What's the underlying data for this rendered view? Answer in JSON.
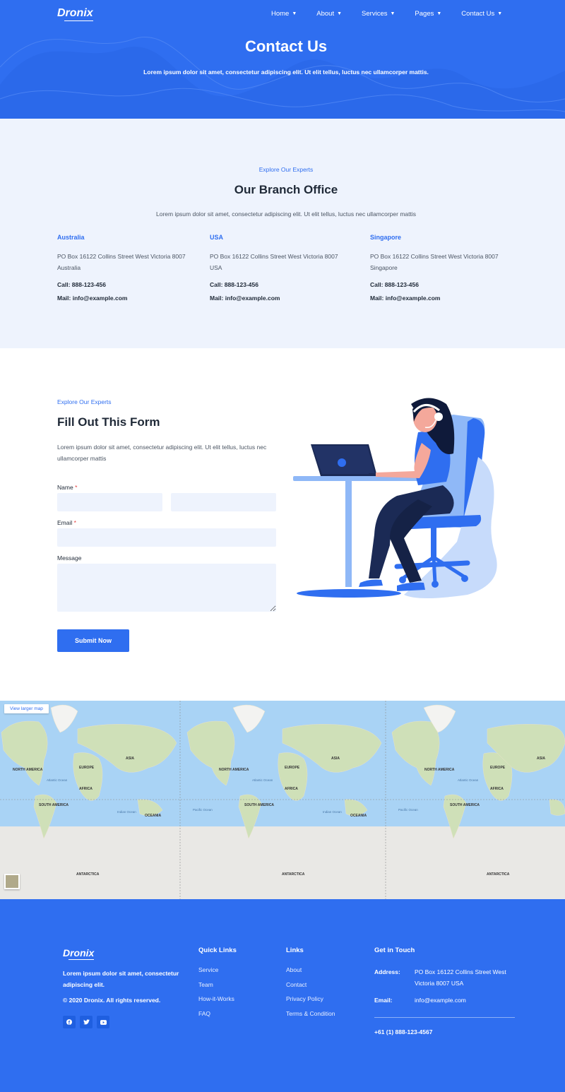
{
  "header": {
    "logo": "Dronix",
    "nav": [
      {
        "label": "Home"
      },
      {
        "label": "About"
      },
      {
        "label": "Services"
      },
      {
        "label": "Pages"
      },
      {
        "label": "Contact Us"
      }
    ],
    "title": "Contact Us",
    "subtitle": "Lorem ipsum dolor sit amet, consectetur adipiscing elit. Ut elit tellus, luctus nec ullamcorper mattis."
  },
  "branch": {
    "eyebrow": "Explore Our Experts",
    "title": "Our Branch Office",
    "lead": "Lorem ipsum dolor sit amet, consectetur adipiscing elit. Ut elit tellus, luctus nec ullamcorper mattis",
    "offices": [
      {
        "city": "Australia",
        "address": "PO Box 16122 Collins Street West Victoria 8007 Australia",
        "call": "Call: 888-123-456",
        "mail": "Mail: info@example.com"
      },
      {
        "city": "USA",
        "address": "PO Box 16122 Collins Street West Victoria 8007 USA",
        "call": "Call: 888-123-456",
        "mail": "Mail: info@example.com"
      },
      {
        "city": "Singapore",
        "address": "PO Box 16122 Collins Street West Victoria 8007 Singapore",
        "call": "Call: 888-123-456",
        "mail": "Mail: info@example.com"
      }
    ]
  },
  "form": {
    "eyebrow": "Explore Our Experts",
    "title": "Fill Out This Form",
    "lead": "Lorem ipsum dolor sit amet, consectetur adipiscing elit. Ut elit tellus, luctus nec ullamcorper mattis",
    "name_label": "Name",
    "email_label": "Email",
    "message_label": "Message",
    "required_mark": "*",
    "first_name_value": "",
    "last_name_value": "",
    "email_value": "",
    "message_value": "",
    "submit_label": "Submit Now"
  },
  "map": {
    "larger_map_label": "View larger map",
    "continents": [
      "NORTH AMERICA",
      "EUROPE",
      "ASIA",
      "AFRICA",
      "SOUTH AMERICA",
      "OCEANIA",
      "ANTARCTICA"
    ],
    "oceans": [
      "Atlantic Ocean",
      "Indian Ocean",
      "Pacific Ocean"
    ]
  },
  "footer": {
    "logo": "Dronix",
    "description": "Lorem ipsum dolor sit amet, consectetur adipiscing elit.",
    "copyright": "© 2020 Dronix. All rights reserved.",
    "socials": [
      {
        "icon": "facebook-icon"
      },
      {
        "icon": "twitter-icon"
      },
      {
        "icon": "youtube-icon"
      }
    ],
    "quick_links_title": "Quick Links",
    "quick_links": [
      "Service",
      "Team",
      "How-it-Works",
      "FAQ"
    ],
    "links_title": "Links",
    "links": [
      "About",
      "Contact",
      "Privacy Policy",
      "Terms & Condition"
    ],
    "contact_title": "Get in Touch",
    "address_key": "Address:",
    "address_value": "PO Box 16122 Collins Street West Victoria 8007 USA",
    "email_key": "Email:",
    "email_value": "info@example.com",
    "phone": "+61 (1) 888-123-4567"
  },
  "colors": {
    "brand": "#2f6ef0",
    "section_bg": "#eef3fd",
    "map_water": "#a9d3f5"
  }
}
